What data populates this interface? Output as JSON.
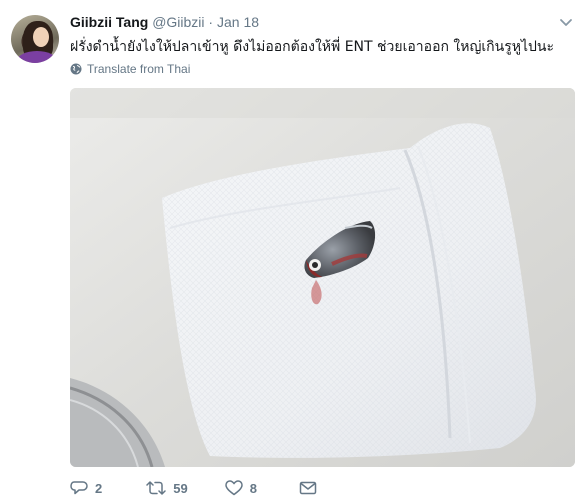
{
  "tweet": {
    "author_name": "Giibzii Tang",
    "author_handle": "@Giibzii",
    "separator": "·",
    "date": "Jan 18",
    "text": "ฝรั่งดำน้ำยังไงให้ปลาเข้าหู ดึงไม่ออกต้องให้พี่ ENT ช่วยเอาออก ใหญ่เกินรูหูไปนะ",
    "translate_label": "Translate from Thai"
  },
  "icons": {
    "menu": "chevron-down-icon",
    "translate": "globe-icon",
    "reply": "reply-icon",
    "retweet": "retweet-icon",
    "like": "heart-icon",
    "message": "envelope-icon"
  },
  "actions": {
    "reply_count": "2",
    "retweet_count": "59",
    "like_count": "8"
  },
  "colors": {
    "secondary_text": "#657786",
    "primary_text": "#14171a"
  }
}
